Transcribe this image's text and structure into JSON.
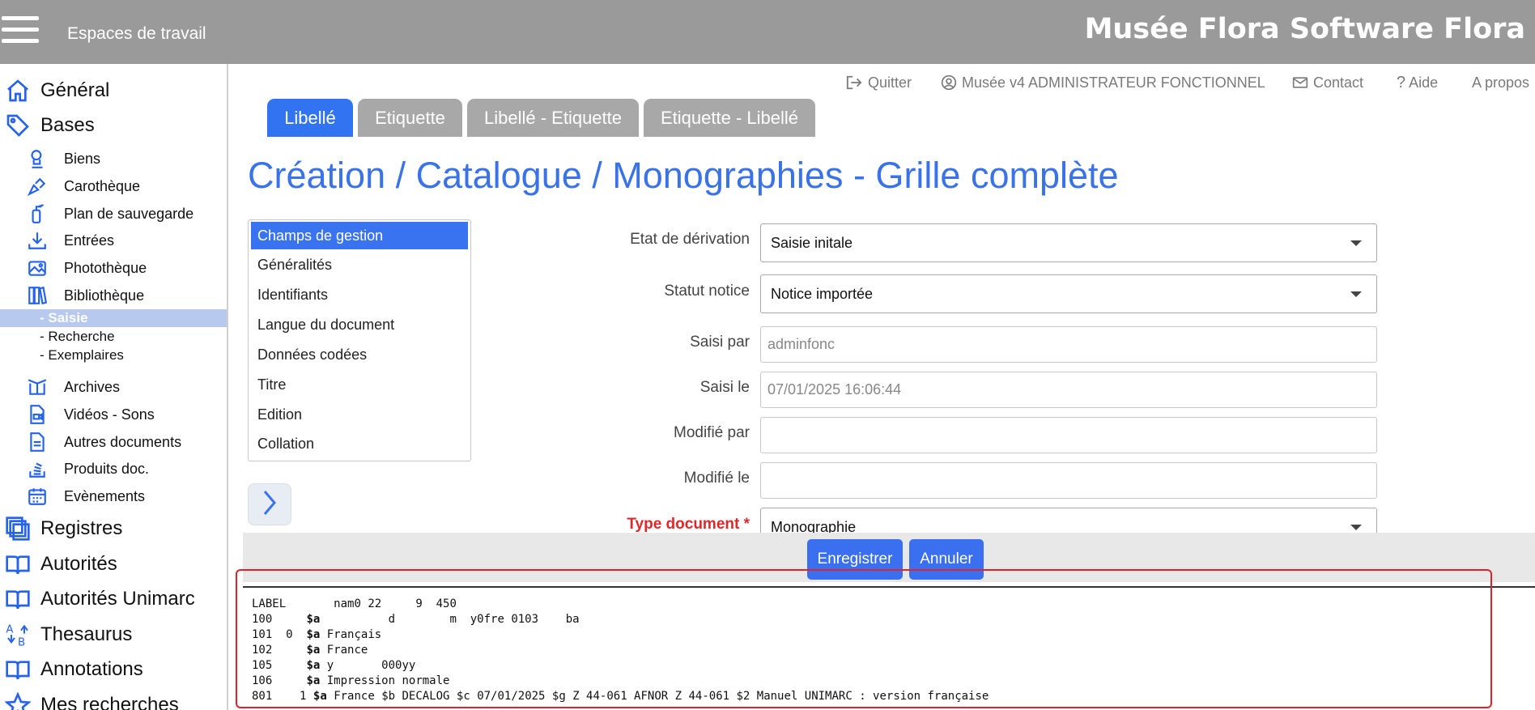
{
  "header": {
    "menu_icon": "hamburger-icon",
    "workspaces_label": "Espaces de travail",
    "brand": "Musée Flora Software Flora",
    "bg_color": "#9a9a9a"
  },
  "topmenu": {
    "quit": "Quitter",
    "user": "Musée v4 ADMINISTRATEUR FONCTIONNEL",
    "contact": "Contact",
    "help": "Aide",
    "about": "A propos"
  },
  "sidebar": {
    "general": "Général",
    "bases": "Bases",
    "items": {
      "biens": "Biens",
      "carotheque": "Carothèque",
      "plan": "Plan de sauvegarde",
      "entrees": "Entrées",
      "phototheque": "Photothèque",
      "bibliotheque": "Bibliothèque",
      "saisie": "- Saisie",
      "recherche": "- Recherche",
      "exemplaires": "- Exemplaires",
      "archives": "Archives",
      "videos": "Vidéos - Sons",
      "autres": "Autres documents",
      "produits": "Produits doc.",
      "evenements": "Evènements"
    },
    "registres": "Registres",
    "autorites": "Autorités",
    "autorites_unimarc": "Autorités Unimarc",
    "thesaurus": "Thesaurus",
    "annotations": "Annotations",
    "mes_recherches": "Mes recherches",
    "accent_color": "#2563eb"
  },
  "tabs": [
    "Libellé",
    "Etiquette",
    "Libellé - Etiquette",
    "Etiquette - Libellé"
  ],
  "page_title": "Création / Catalogue / Monographies - Grille complète",
  "sections": [
    "Champs de gestion",
    "Généralités",
    "Identifiants",
    "Langue du document",
    "Données codées",
    "Titre",
    "Edition",
    "Collation"
  ],
  "form": {
    "etat_label": "Etat de dérivation",
    "etat_value": "Saisie initale",
    "statut_label": "Statut notice",
    "statut_value": "Notice importée",
    "saisi_par_label": "Saisi par",
    "saisi_par_value": "adminfonc",
    "saisi_le_label": "Saisi le",
    "saisi_le_value": "07/01/2025 16:06:44",
    "modifie_par_label": "Modifié par",
    "modifie_par_value": "",
    "modifie_le_label": "Modifié le",
    "modifie_le_value": "",
    "type_label": "Type document *",
    "type_value": "Monographie"
  },
  "actions": {
    "save": "Enregistrer",
    "cancel": "Annuler"
  },
  "unimarc": [
    {
      "tag": "LABEL",
      "ind": "",
      "content": "nam0 22     9  450"
    },
    {
      "tag": "100",
      "ind": "",
      "sub": "$a",
      "content": "         d        m  y0fre 0103    ba"
    },
    {
      "tag": "101",
      "ind": "0",
      "sub": "$a",
      "content": "Français"
    },
    {
      "tag": "102",
      "ind": "",
      "sub": "$a",
      "content": "France"
    },
    {
      "tag": "105",
      "ind": "",
      "sub": "$a",
      "content": "y       000yy"
    },
    {
      "tag": "106",
      "ind": "",
      "sub": "$a",
      "content": "Impression normale"
    },
    {
      "tag": "801",
      "ind": "1",
      "sub": "$a",
      "content": "France $b DECALOG $c 07/01/2025 $g Z 44-061 AFNOR Z 44-061 $2 Manuel UNIMARC : version française"
    }
  ]
}
